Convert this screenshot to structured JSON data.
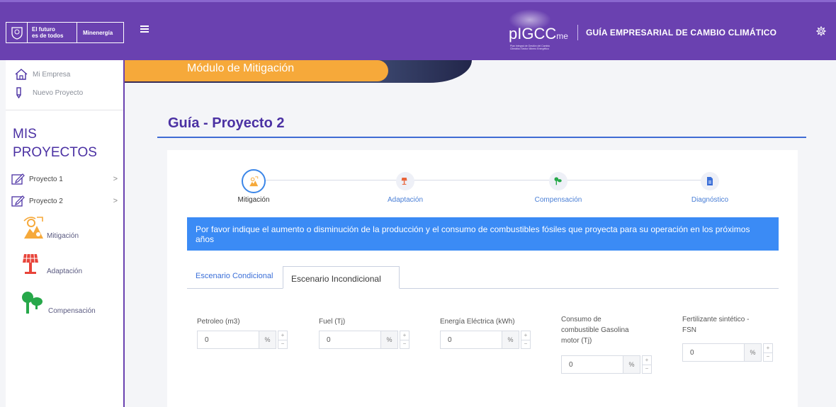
{
  "header": {
    "gov_logo": {
      "line1": "El futuro",
      "line2": "es de todos",
      "ministry": "Minenergía"
    },
    "brand": {
      "name": "pIGCC",
      "suffix": "me",
      "tagline": "Plan Integral de Gestión del Cambio Climático Sector Minero Energético"
    },
    "title": "GUÍA EMPRESARIAL DE CAMBIO CLIMÁTICO",
    "colors": {
      "primary": "#6a41b0",
      "accent": "#f6a93a",
      "info": "#3b8bf5"
    }
  },
  "sidebar": {
    "top_items": [
      {
        "label": "Mi Empresa",
        "icon": "home-icon"
      },
      {
        "label": "Nuevo Proyecto",
        "icon": "pencil-icon"
      }
    ],
    "section_title_1": "MIS",
    "section_title_2": "PROYECTOS",
    "projects": [
      {
        "label": "Proyecto 1",
        "chevron": ">"
      },
      {
        "label": "Proyecto 2",
        "chevron": ">"
      }
    ],
    "sub_items": [
      {
        "label": "Mitigación",
        "icon": "mitigation-icon"
      },
      {
        "label": "Adaptación",
        "icon": "solar-panel-icon"
      },
      {
        "label": "Compensación",
        "icon": "trees-icon"
      }
    ]
  },
  "banner": {
    "module_title": "Módulo de Mitigación"
  },
  "page": {
    "title": "Guía - Proyecto 2"
  },
  "steps": [
    {
      "label": "Mitigación",
      "active": true
    },
    {
      "label": "Adaptación",
      "active": false
    },
    {
      "label": "Compensación",
      "active": false
    },
    {
      "label": "Diagnóstico",
      "active": false
    }
  ],
  "info_text": "Por favor indique el aumento o disminución de la producción y el consumo de combustibles fósiles que proyecta para su operación en los próximos años",
  "tabs": [
    {
      "label": "Escenario Condicional",
      "active": false
    },
    {
      "label": "Escenario Incondicional",
      "active": true
    }
  ],
  "fields": [
    {
      "label": "Petroleo (m3)",
      "value": "0",
      "unit": "%"
    },
    {
      "label": "Fuel (Tj)",
      "value": "0",
      "unit": "%"
    },
    {
      "label": "Energía Eléctrica (kWh)",
      "value": "0",
      "unit": "%"
    },
    {
      "label": "Consumo de combustible Gasolina motor (Tj)",
      "label_lines": [
        "Consumo de",
        "combustible Gasolina",
        "motor (Tj)"
      ],
      "value": "0",
      "unit": "%"
    },
    {
      "label": "Fertilizante sintético - FSN",
      "label_lines": [
        "Fertilizante sintético -",
        "FSN"
      ],
      "value": "0",
      "unit": "%"
    }
  ],
  "spinner": {
    "up": "+",
    "down": "−"
  }
}
